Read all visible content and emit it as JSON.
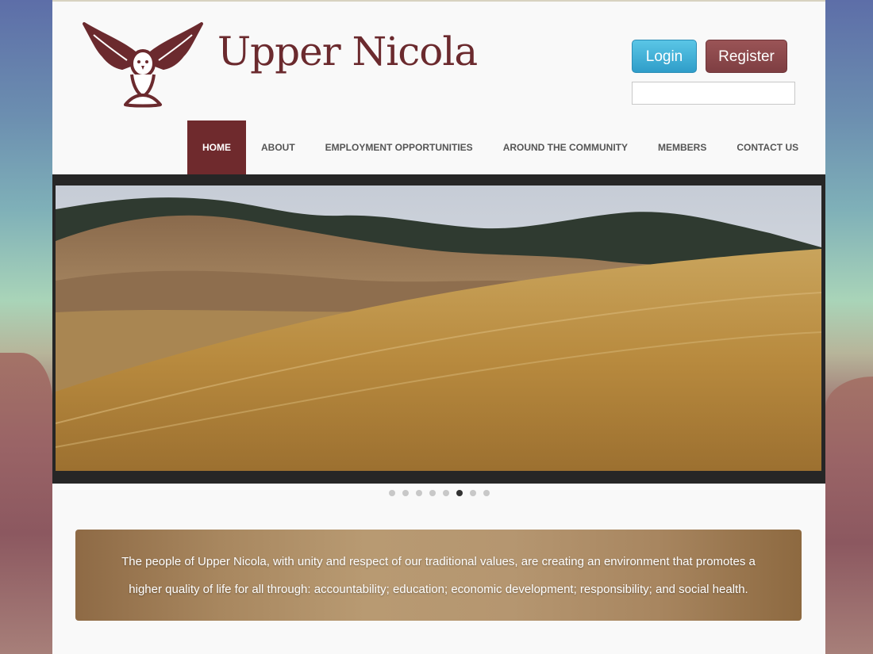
{
  "header": {
    "brand_name": "Upper Nicola"
  },
  "auth": {
    "login_label": "Login",
    "register_label": "Register",
    "search_value": ""
  },
  "nav": {
    "items": [
      {
        "label": "HOME",
        "active": true
      },
      {
        "label": "ABOUT",
        "active": false
      },
      {
        "label": "EMPLOYMENT OPPORTUNITIES",
        "active": false
      },
      {
        "label": "AROUND THE COMMUNITY",
        "active": false
      },
      {
        "label": "MEMBERS",
        "active": false
      },
      {
        "label": "CONTACT US",
        "active": false
      }
    ]
  },
  "slider": {
    "slide_count": 8,
    "active_index": 5,
    "image": "golden-grass-field-hills"
  },
  "mission": {
    "text": "The people of Upper Nicola, with unity and respect of our traditional values, are creating an environment that promotes a higher quality of life for all through: accountability; education; economic development; responsibility; and social health."
  },
  "colors": {
    "brand": "#6f2a2d",
    "login": "#3aaed7",
    "register": "#8a4649",
    "slider_frame": "#262626"
  },
  "icons": {
    "logo": "eagle-logo-icon"
  }
}
